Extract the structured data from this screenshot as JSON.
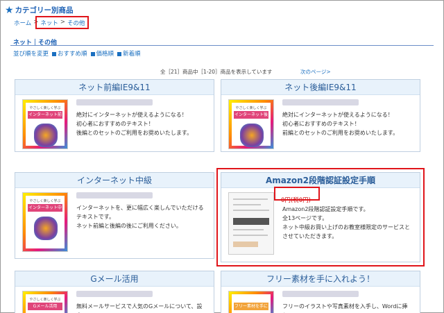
{
  "header": {
    "star_icon": "star-icon",
    "title": "カテゴリー別商品"
  },
  "breadcrumb": {
    "home": "ホーム",
    "sep": ">",
    "net": "ネット",
    "other": "その他"
  },
  "subheader": "ネット｜その他",
  "sort": {
    "label": "並び順を変更",
    "recommend": "おすすめ順",
    "price": "価格順",
    "newest": "新着順"
  },
  "listing": {
    "count": "全［21］商品中［1-20］商品を表示しています",
    "next": "次のページ>"
  },
  "cards": [
    {
      "title": "ネット前編IE9&11",
      "thumb_caption": "やさしく楽しく学ぶ",
      "thumb_title": "インターネット前編",
      "desc": [
        "絶対にインターネットが使えるようになる！",
        "初心者におすすめのテキスト！",
        "後編とのセットのご利用をお奨めいたします。"
      ]
    },
    {
      "title": "ネット後編IE9&11",
      "thumb_caption": "やさしく楽しく学ぶ",
      "thumb_title": "インターネット後編",
      "desc": [
        "絶対にインターネットが使えるようになる！",
        "初心者におすすめのテキスト！",
        "前編とのセットのご利用をお奨めいたします。"
      ]
    },
    {
      "title": "インターネット中級",
      "thumb_caption": "やさしく楽しく学ぶ",
      "thumb_title": "インターネット中級",
      "desc": [
        "インターネットを、更に幅広く楽しんでいただけるテキストです。",
        "ネット前編と後編の後にご利用ください。"
      ]
    },
    {
      "title": "Amazon2段階認証設定手順",
      "price": "0円(税0円)",
      "desc": [
        "Amazon2段階認証設定手順です。",
        "全13ページです。",
        "ネット中級お買い上げのお教室様限定のサービスとさせていただきます。"
      ]
    },
    {
      "title": "Gメール活用",
      "thumb_caption": "やさしく楽しく学ぶ",
      "thumb_title": "Gメール活用",
      "desc": [
        "無料メールサービスで人気のGメールについて、設定"
      ]
    },
    {
      "title": "フリー素材を手に入れよう！",
      "thumb_caption": "",
      "thumb_title": "フリー素材を手に入れよう",
      "desc": [
        "フリーのイラストや写真素材を入手し、Wordに挿入"
      ]
    }
  ]
}
